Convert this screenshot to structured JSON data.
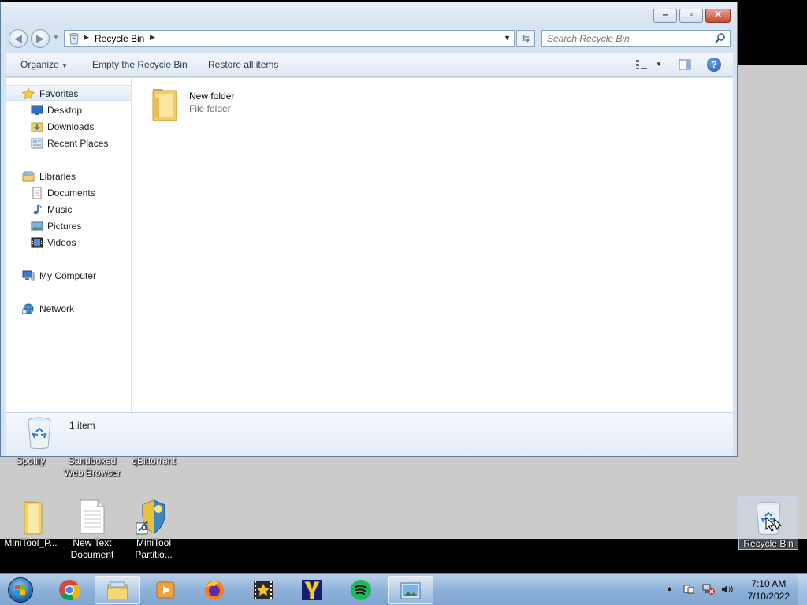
{
  "window": {
    "address": {
      "crumb": "Recycle Bin"
    },
    "search": {
      "placeholder": "Search Recycle Bin"
    },
    "toolbar": {
      "organize": "Organize",
      "empty": "Empty the Recycle Bin",
      "restore": "Restore all items"
    },
    "nav": {
      "favorites": {
        "label": "Favorites",
        "items": [
          "Desktop",
          "Downloads",
          "Recent Places"
        ]
      },
      "libraries": {
        "label": "Libraries",
        "items": [
          "Documents",
          "Music",
          "Pictures",
          "Videos"
        ]
      },
      "computer": "My Computer",
      "network": "Network"
    },
    "files": [
      {
        "name": "New folder",
        "type": "File folder"
      }
    ],
    "details": {
      "count": "1 item"
    }
  },
  "desktop": {
    "icons_top": [
      "Spotify",
      "Sandboxed Web Browser",
      "qBittorrent"
    ],
    "icons_bottom": [
      "MiniTool_P...",
      "New Text Document",
      "MiniTool Partitio..."
    ],
    "recycle_bin": "Recycle Bin"
  },
  "taskbar": {
    "apps": [
      "chrome",
      "file-explorer",
      "media-player",
      "firefox",
      "movie-maker",
      "app-y",
      "spotify",
      "photo-viewer"
    ],
    "clock": {
      "time": "7:10 AM",
      "date": "7/10/2022"
    }
  },
  "colors": {
    "taskbar": "#8eb2d9",
    "window_frame": "#d6e3f1",
    "desktop": "#cbcbcb",
    "close_button": "#c74a30"
  }
}
